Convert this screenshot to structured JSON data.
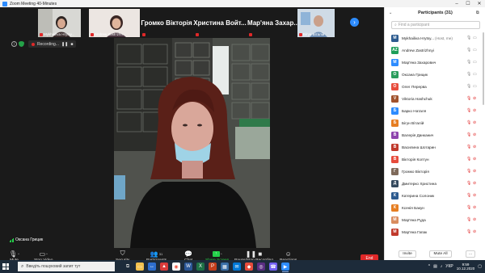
{
  "window": {
    "title": "Zoom Meeting 40-Minutes"
  },
  "thumbnails": [
    {
      "name": "Mykhailiva Hrytsy...",
      "muted": true
    },
    {
      "name": "Andrew Zastrizhn...",
      "muted": true
    },
    {
      "name": "Громко Вікторія",
      "muted": true
    },
    {
      "name": "Христина Войт...",
      "muted": true
    },
    {
      "name": "Мар'яна Захар...",
      "muted": true
    },
    {
      "name": "Бігун Віталій",
      "muted": true
    }
  ],
  "recording": {
    "label": "Recording..."
  },
  "speaker": {
    "name": "Оксана Грицик"
  },
  "toolbar": {
    "mute": "Mute",
    "stop_video": "Stop Video",
    "security": "Security",
    "participants": "Participants",
    "participants_count": "31",
    "chat": "Chat",
    "share_screen": "Share Screen",
    "record": "Pause/Stop Recording",
    "reactions": "Reactions",
    "end": "End"
  },
  "panel": {
    "title": "Participants (31)",
    "search_placeholder": "Find a participant",
    "invite": "Invite",
    "mute_all": "Mute All",
    "more": "..."
  },
  "participants": [
    {
      "initials": "M",
      "color": "#2d5b8f",
      "name": "Mykhailiva Hrytsy...",
      "tag": "(Host, me)",
      "mic": "on",
      "cam": "on"
    },
    {
      "initials": "AZ",
      "color": "#1e9e5a",
      "name": "Andrew Zastrizhnyi",
      "tag": "",
      "mic": "on",
      "cam": "on"
    },
    {
      "initials": "M",
      "color": "#2d8cff",
      "name": "Мар'яна Захарович",
      "tag": "",
      "mic": "on",
      "cam": "on"
    },
    {
      "initials": "O",
      "color": "#2a9d5c",
      "name": "Оксана Грицик",
      "tag": "",
      "mic": "on",
      "cam": "on"
    },
    {
      "initials": "O",
      "color": "#e74c3c",
      "name": "Олег Перерва",
      "tag": "",
      "mic": "on",
      "cam": "on"
    },
    {
      "initials": "V",
      "color": "#a0522d",
      "name": "Viktoria Hashchuk",
      "tag": "",
      "mic": "off",
      "cam": "off"
    },
    {
      "initials": "Б",
      "color": "#2d8cff",
      "name": "Барко Наталя",
      "tag": "",
      "mic": "off",
      "cam": "off"
    },
    {
      "initials": "Б",
      "color": "#e67e22",
      "name": "Бігун Віталій",
      "tag": "",
      "mic": "off",
      "cam": "off"
    },
    {
      "initials": "B",
      "color": "#8e44ad",
      "name": "Валерія Данканич",
      "tag": "",
      "mic": "off",
      "cam": "off"
    },
    {
      "initials": "B",
      "color": "#c0392b",
      "name": "Василина Шотарин",
      "tag": "",
      "mic": "off",
      "cam": "off"
    },
    {
      "initials": "B",
      "color": "#e74c3c",
      "name": "Вікторія Колтун",
      "tag": "",
      "mic": "off",
      "cam": "off"
    },
    {
      "initials": "Г",
      "color": "#7f6a5a",
      "name": "Громко Вікторія",
      "tag": "",
      "mic": "off",
      "cam": "off"
    },
    {
      "initials": "Д",
      "color": "#34495e",
      "name": "Дмитерко Христина",
      "tag": "",
      "mic": "off",
      "cam": "off"
    },
    {
      "initials": "К",
      "color": "#2d5b8f",
      "name": "Катерина Солоник",
      "tag": "",
      "mic": "off",
      "cam": "off"
    },
    {
      "initials": "К",
      "color": "#e67e22",
      "name": "Ксенія Бакун",
      "tag": "",
      "mic": "off",
      "cam": "off"
    },
    {
      "initials": "M",
      "color": "#d98c5f",
      "name": "Мар'яна Руда",
      "tag": "",
      "mic": "off",
      "cam": "off"
    },
    {
      "initials": "M",
      "color": "#c0392b",
      "name": "Мар'яна Гапак",
      "tag": "",
      "mic": "off",
      "cam": "off"
    }
  ],
  "taskbar": {
    "search_placeholder": "Введіть пошуковий запит тут",
    "lang": "УКР",
    "time": "9:59",
    "date": "10.12.2020"
  },
  "colors": {
    "zoom_blue": "#2d8cff",
    "end_red": "#e02828",
    "share_green": "#24d14a"
  }
}
